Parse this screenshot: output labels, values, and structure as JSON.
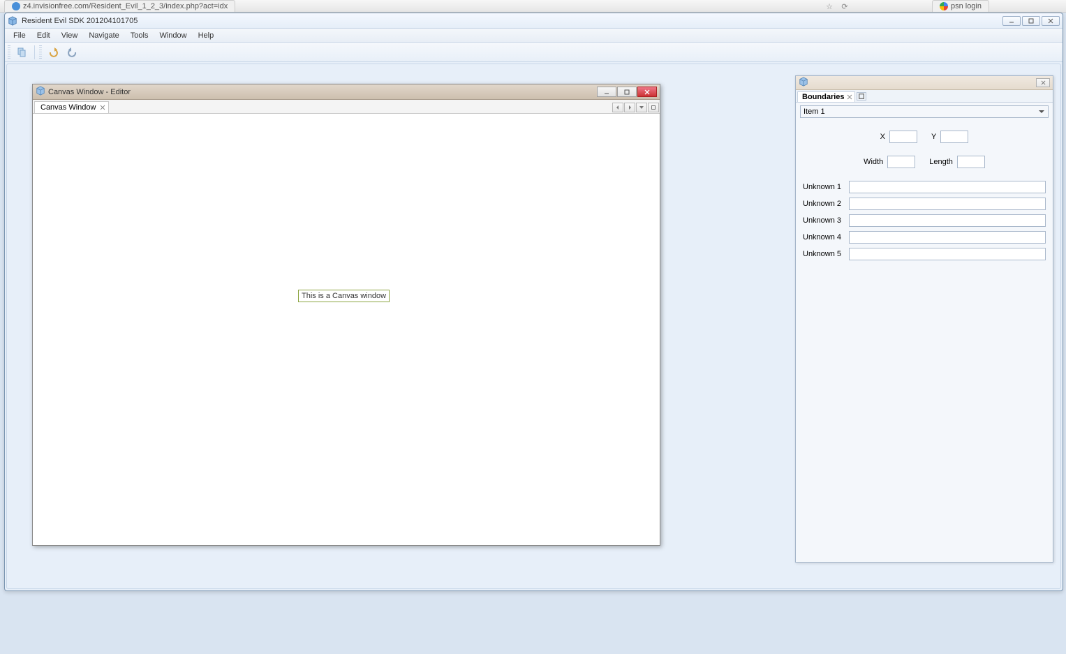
{
  "browser": {
    "tab1_text": "z4.invisionfree.com/Resident_Evil_1_2_3/index.php?act=idx",
    "tab2_text": "psn login"
  },
  "app": {
    "title": "Resident Evil SDK 201204101705"
  },
  "menu": {
    "file": "File",
    "edit": "Edit",
    "view": "View",
    "navigate": "Navigate",
    "tools": "Tools",
    "window": "Window",
    "help": "Help"
  },
  "editor": {
    "window_title": "Canvas Window - Editor",
    "tab_label": "Canvas Window",
    "canvas_text": "This is a Canvas window"
  },
  "props": {
    "tab_label": "Boundaries",
    "dropdown_selected": "Item 1",
    "coords": {
      "x_label": "X",
      "y_label": "Y",
      "width_label": "Width",
      "length_label": "Length",
      "x_value": "",
      "y_value": "",
      "width_value": "",
      "length_value": ""
    },
    "fields": {
      "u1_label": "Unknown 1",
      "u2_label": "Unknown 2",
      "u3_label": "Unknown 3",
      "u4_label": "Unknown 4",
      "u5_label": "Unknown 5",
      "u1_value": "",
      "u2_value": "",
      "u3_value": "",
      "u4_value": "",
      "u5_value": ""
    }
  }
}
